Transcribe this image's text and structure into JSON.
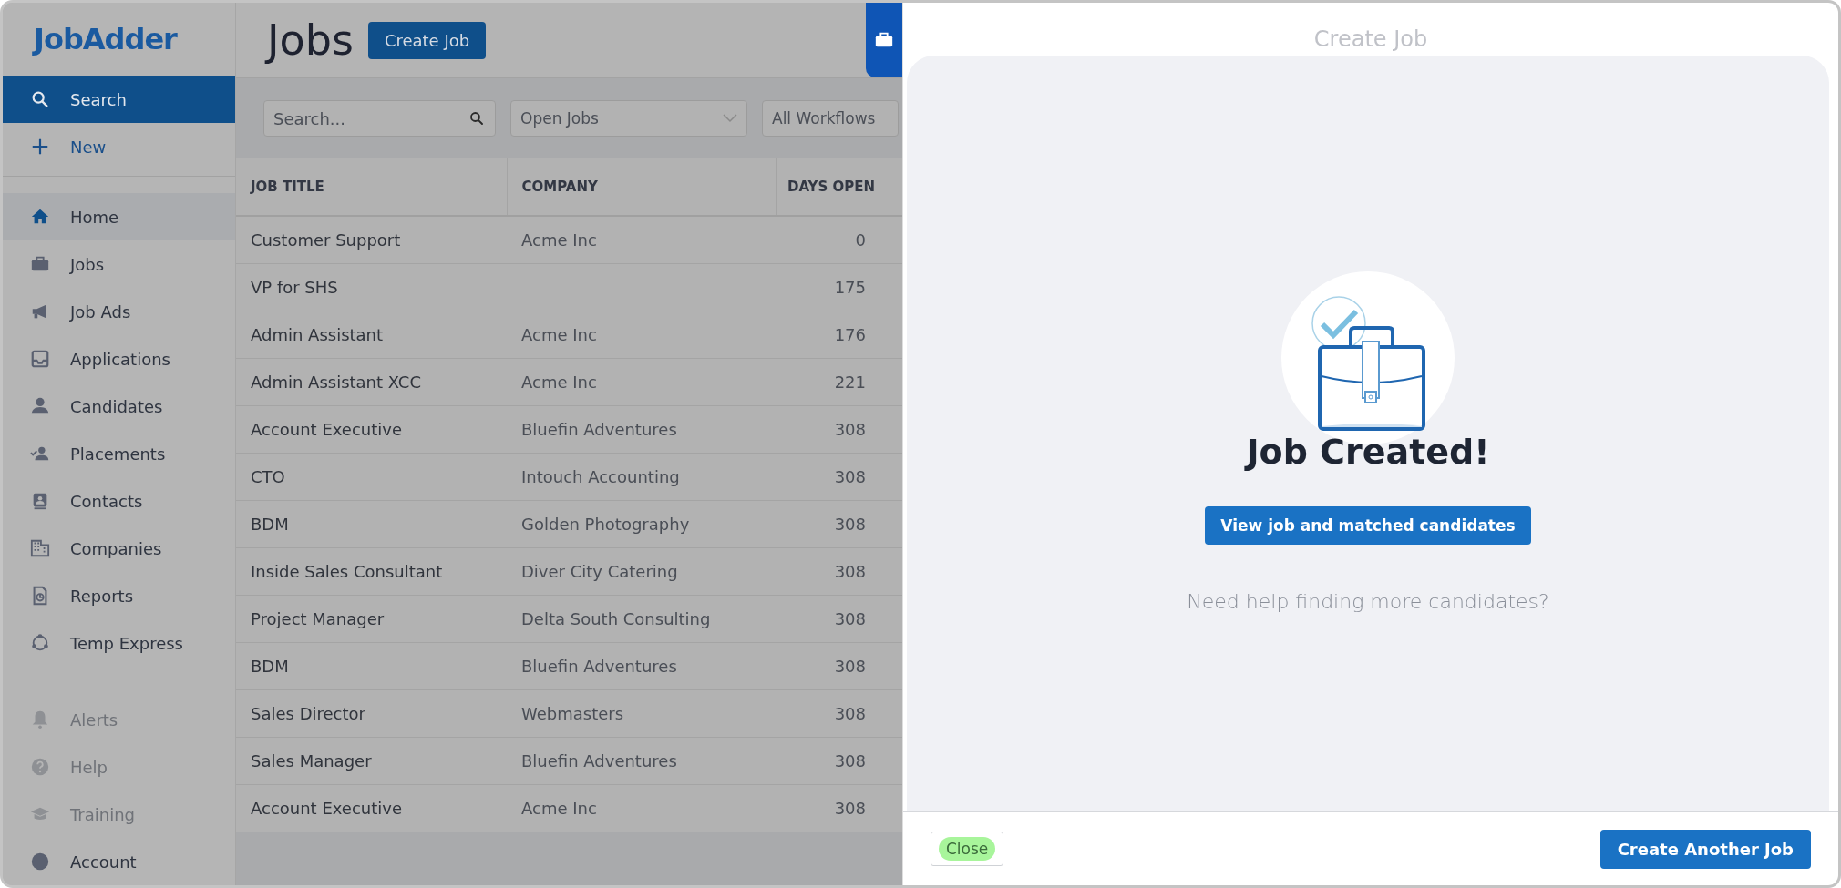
{
  "logo": "JobAdder",
  "sidebar": {
    "actions": [
      {
        "label": "Search",
        "selected": true
      },
      {
        "label": "New",
        "selected": false
      }
    ],
    "items": [
      {
        "label": "Home",
        "selected": true,
        "disabled": false
      },
      {
        "label": "Jobs",
        "selected": false,
        "disabled": false
      },
      {
        "label": "Job Ads",
        "selected": false,
        "disabled": false
      },
      {
        "label": "Applications",
        "selected": false,
        "disabled": false
      },
      {
        "label": "Candidates",
        "selected": false,
        "disabled": false
      },
      {
        "label": "Placements",
        "selected": false,
        "disabled": false
      },
      {
        "label": "Contacts",
        "selected": false,
        "disabled": false
      },
      {
        "label": "Companies",
        "selected": false,
        "disabled": false
      },
      {
        "label": "Reports",
        "selected": false,
        "disabled": false
      },
      {
        "label": "Temp Express",
        "selected": false,
        "disabled": false
      }
    ],
    "footer_items": [
      {
        "label": "Alerts",
        "disabled": true
      },
      {
        "label": "Help",
        "disabled": true
      },
      {
        "label": "Training",
        "disabled": true
      },
      {
        "label": "Account",
        "disabled": false
      }
    ]
  },
  "page": {
    "title": "Jobs",
    "create_button": "Create Job"
  },
  "filters": {
    "search": {
      "placeholder": "Search..."
    },
    "status": "Open Jobs",
    "workflow": "All Workflows"
  },
  "table": {
    "columns": [
      "JOB TITLE",
      "COMPANY",
      "DAYS OPEN"
    ],
    "rows": [
      [
        "Customer Support",
        "Acme Inc",
        "0"
      ],
      [
        "VP for SHS",
        "",
        "175"
      ],
      [
        "Admin Assistant",
        "Acme Inc",
        "176"
      ],
      [
        "Admin Assistant XCC",
        "Acme Inc",
        "221"
      ],
      [
        "Account Executive",
        "Bluefin Adventures",
        "308"
      ],
      [
        "CTO",
        "Intouch Accounting",
        "308"
      ],
      [
        "BDM",
        "Golden Photography",
        "308"
      ],
      [
        "Inside Sales Consultant",
        "Diver City Catering",
        "308"
      ],
      [
        "Project Manager",
        "Delta South Consulting",
        "308"
      ],
      [
        "BDM",
        "Bluefin Adventures",
        "308"
      ],
      [
        "Sales Director",
        "Webmasters",
        "308"
      ],
      [
        "Sales Manager",
        "Bluefin Adventures",
        "308"
      ],
      [
        "Account Executive",
        "Acme Inc",
        "308"
      ]
    ]
  },
  "dialog": {
    "title": "Create Job",
    "heading": "Job Created!",
    "primary_button": "View job and matched candidates",
    "help_text": "Need help finding more candidates?",
    "close_button": "Close",
    "create_another_button": "Create Another Job"
  }
}
